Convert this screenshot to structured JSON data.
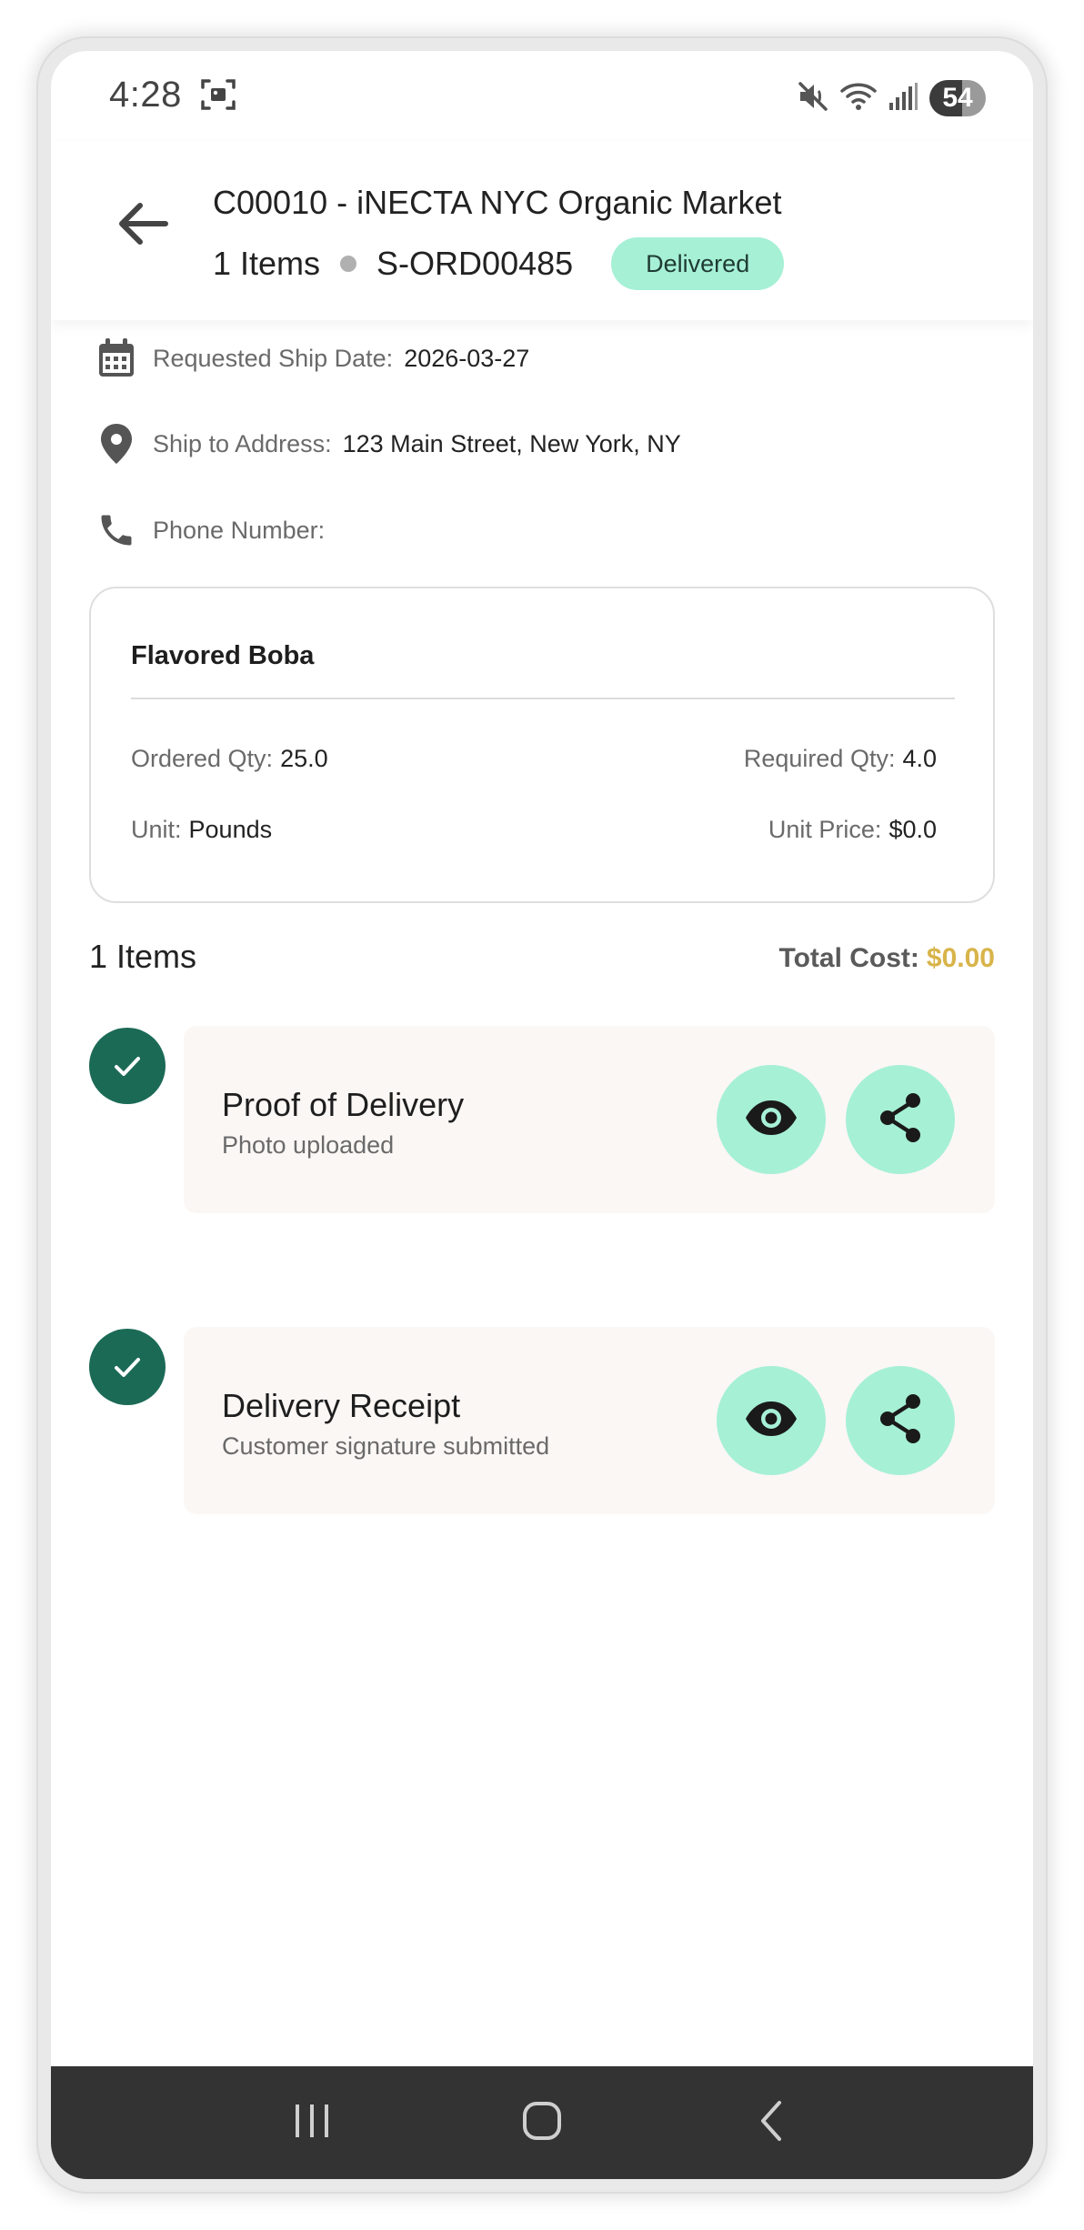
{
  "status_bar": {
    "time": "4:28",
    "battery": "54",
    "icons": [
      "screenshot-icon",
      "mute-icon",
      "wifi-icon",
      "signal-icon",
      "battery-icon"
    ]
  },
  "header": {
    "title": "C00010 - iNECTA NYC Organic Market",
    "items_count": "1 Items",
    "order_id": "S-ORD00485",
    "status": "Delivered"
  },
  "info": {
    "ship_date_label": "Requested Ship Date:",
    "ship_date_value": "2026-03-27",
    "address_label": "Ship to Address:",
    "address_value": "123 Main Street, New York, NY",
    "phone_label": "Phone Number:",
    "phone_value": ""
  },
  "item": {
    "name": "Flavored Boba",
    "ordered_qty_label": "Ordered Qty:",
    "ordered_qty_value": "25.0",
    "required_qty_label": "Required Qty:",
    "required_qty_value": "4.0",
    "unit_label": "Unit:",
    "unit_value": "Pounds",
    "unit_price_label": "Unit Price:",
    "unit_price_value": "$0.0"
  },
  "summary": {
    "items_count": "1 Items",
    "total_label": "Total Cost:",
    "total_value": "$0.00"
  },
  "documents": [
    {
      "title": "Proof of Delivery",
      "subtitle": "Photo uploaded"
    },
    {
      "title": "Delivery Receipt",
      "subtitle": "Customer signature submitted"
    }
  ],
  "colors": {
    "accent_green": "#a6f0d6",
    "check_green": "#1b6a56",
    "total_gold": "#d8b44a",
    "nav_bar": "#333333"
  }
}
